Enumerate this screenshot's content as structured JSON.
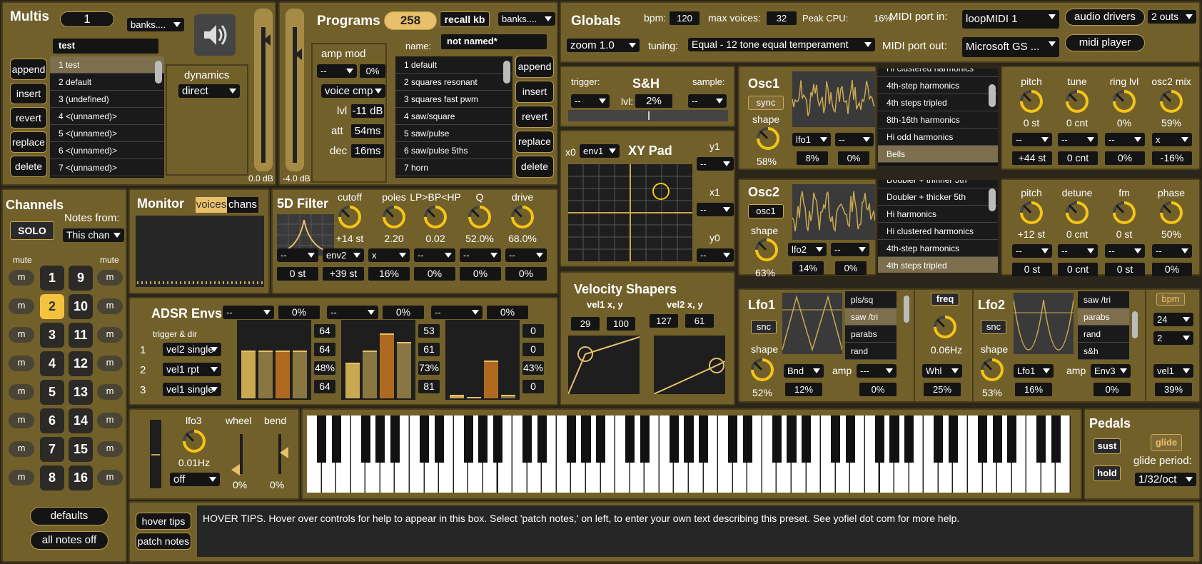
{
  "multis": {
    "title": "Multis",
    "number": "1",
    "banks": "banks....",
    "name": "test",
    "volume": "0.0 dB",
    "buttons": [
      "append",
      "insert",
      "revert",
      "replace",
      "delete"
    ],
    "list": [
      "1 test",
      "2 default",
      "3 (undefined)",
      "4 <(unnamed)>",
      "5 <(unnamed)>",
      "6 <(unnamed)>",
      "7 <(unnamed)>"
    ],
    "dynamics_label": "dynamics",
    "dynamics": "direct"
  },
  "programs": {
    "title": "Programs",
    "number": "258",
    "recall": "recall kb",
    "banks": "banks....",
    "name_label": "name:",
    "name": "not named*",
    "volume": "-4.0 dB",
    "buttons": [
      "append",
      "insert",
      "revert",
      "replace",
      "delete"
    ],
    "list": [
      "1 default",
      "2 squares resonant",
      "3 squares fast pwm",
      "4 saw/square",
      "5 saw/pulse",
      "6 saw/pulse 5ths",
      "7 horn"
    ],
    "amp_mod": {
      "title": "amp mod",
      "src": "--",
      "pct": "0%",
      "mode": "voice cmp",
      "lvl_label": "lvl",
      "lvl": "-11 dB",
      "att_label": "att",
      "att": "54ms",
      "dec_label": "dec",
      "dec": "16ms"
    }
  },
  "globals": {
    "title": "Globals",
    "bpm_label": "bpm:",
    "bpm": "120",
    "maxv_label": "max voices:",
    "maxv": "32",
    "cpu_label": "Peak CPU:",
    "cpu": "16%",
    "midi_in_label": "MIDI port in:",
    "midi_in": "loopMIDI 1",
    "audio_drivers": "audio drivers",
    "outs": "2 outs",
    "zoom": "zoom 1.0",
    "tuning_label": "tuning:",
    "tuning": "Equal - 12 tone equal temperament",
    "midi_out_label": "MIDI port out:",
    "midi_out": "Microsoft GS ...",
    "midi_player": "midi player"
  },
  "sh": {
    "title": "S&H",
    "trigger": "trigger:",
    "sample": "sample:",
    "lvl_label": "lvl:",
    "lvl": "2%",
    "trig_dd": "--",
    "samp_dd": "--"
  },
  "xy": {
    "title": "XY Pad",
    "x0": "x0",
    "x0_src": "env1",
    "y1": "y1",
    "x1": "x1",
    "y0": "y0",
    "dd": "--"
  },
  "osc1": {
    "title": "Osc1",
    "sync": "sync",
    "shape_label": "shape",
    "shape": "58%",
    "lfo": "lfo1",
    "lfo_pct": "8%",
    "dd2": "--",
    "dd2_pct": "0%",
    "list": [
      "Hi clustered harmonics",
      "4th-step harmonics",
      "4th steps tripled",
      "8th-16th harmonics",
      "Hi odd harmonics",
      "Bells"
    ],
    "knobs": [
      {
        "label": "pitch",
        "value": "0 st",
        "dd": "--",
        "box": "+44 st"
      },
      {
        "label": "tune",
        "value": "0 cnt",
        "dd": "--",
        "box": "0 cnt"
      },
      {
        "label": "ring lvl",
        "value": "0%",
        "dd": "--",
        "box": "0%"
      },
      {
        "label": "osc2 mix",
        "value": "59%",
        "dd": "x",
        "box": "-16%"
      }
    ]
  },
  "osc2": {
    "title": "Osc2",
    "src": "osc1",
    "shape_label": "shape",
    "shape": "63%",
    "lfo": "lfo2",
    "lfo_pct": "14%",
    "dd2": "--",
    "dd2_pct": "0%",
    "list": [
      "Doubler + thinner 5th",
      "Doubler + thicker 5th",
      "Hi harmonics",
      "Hi clustered harmonics",
      "4th-step harmonics",
      "4th steps tripled"
    ],
    "knobs": [
      {
        "label": "pitch",
        "value": "+12 st",
        "dd": "--",
        "box": "0 st"
      },
      {
        "label": "detune",
        "value": "0 cnt",
        "dd": "--",
        "box": "0 cnt"
      },
      {
        "label": "fm",
        "value": "0 st",
        "dd": "--",
        "box": "0 st"
      },
      {
        "label": "phase",
        "value": "50%",
        "dd": "--",
        "box": "0%"
      }
    ]
  },
  "channels": {
    "title": "Channels",
    "notes_from": "Notes from:",
    "solo": "SOLO",
    "chan": "This chan",
    "mute": "mute",
    "m": "m",
    "numbers": [
      "1",
      "2",
      "3",
      "4",
      "5",
      "6",
      "7",
      "8",
      "9",
      "10",
      "11",
      "12",
      "13",
      "14",
      "15",
      "16"
    ],
    "defaults": "defaults",
    "all_notes_off": "all notes off"
  },
  "monitor": {
    "title": "Monitor",
    "voices": "voices",
    "chans": "chans"
  },
  "filter": {
    "title": "5D Filter",
    "knobs": [
      {
        "label": "cutoff",
        "value": "+14 st"
      },
      {
        "label": "poles",
        "value": "2.20"
      },
      {
        "label": "LP>BP<HP",
        "value": "0.02"
      },
      {
        "label": "Q",
        "value": "52.0%"
      },
      {
        "label": "drive",
        "value": "68.0%"
      }
    ],
    "mods": [
      {
        "dd": "--",
        "val": "0 st"
      },
      {
        "dd": "env2",
        "val": "+39 st"
      },
      {
        "dd": "x",
        "val": "16%"
      },
      {
        "dd": "--",
        "val": "0%"
      },
      {
        "dd": "--",
        "val": "0%"
      },
      {
        "dd": "--",
        "val": "0%"
      }
    ]
  },
  "adsr": {
    "title": "ADSR Envs",
    "trigger": "trigger & dir",
    "rows": [
      {
        "n": "1",
        "mode": "vel2 single"
      },
      {
        "n": "2",
        "mode": "vel1 rpt"
      },
      {
        "n": "3",
        "mode": "vel1 single"
      }
    ],
    "heads": [
      {
        "dd": "--",
        "pct": "0%"
      },
      {
        "dd": "--",
        "pct": "0%"
      },
      {
        "dd": "--",
        "pct": "0%"
      }
    ],
    "env1": [
      "64",
      "64",
      "48%",
      "64"
    ],
    "env2": [
      "53",
      "61",
      "73%",
      "81"
    ],
    "env3": [
      "0",
      "0",
      "43%",
      "0"
    ]
  },
  "velocity": {
    "title": "Velocity Shapers",
    "v1": "vel1 x, y",
    "v1x": "29",
    "v1y": "100",
    "v2": "vel2 x, y",
    "v2x": "127",
    "v2y": "61"
  },
  "lfo1": {
    "title": "Lfo1",
    "snc": "snc",
    "shape_label": "shape",
    "shape": "52%",
    "mod": "Bnd",
    "mod_pct": "12%",
    "amp": "amp",
    "amp_dd": "---",
    "amp_pct": "0%",
    "list": [
      "pls/sq",
      "saw /tri",
      "parabs",
      "rand"
    ],
    "freq": "freq",
    "hz": "0.06Hz",
    "whl": "Whl",
    "whl_pct": "25%"
  },
  "lfo2": {
    "title": "Lfo2",
    "snc": "snc",
    "shape_label": "shape",
    "shape": "53%",
    "mod": "Lfo1",
    "mod_pct": "16%",
    "amp": "amp",
    "amp_dd": "Env3",
    "amp_pct": "0%",
    "list": [
      "saw /tri",
      "parabs",
      "rand",
      "s&h"
    ],
    "bpm": "bpm",
    "d1": "24",
    "d2": "2",
    "vel": "vel1",
    "vel_pct": "39%"
  },
  "perf": {
    "lfo3": "lfo3",
    "hz": "0.01Hz",
    "off": "off",
    "wheel": "wheel",
    "bend": "bend",
    "wheel_pct": "0%",
    "bend_pct": "0%"
  },
  "pedals": {
    "title": "Pedals",
    "sust": "sust",
    "glide": "glide",
    "hold": "hold",
    "period_label": "glide period:",
    "period": "1/32/oct"
  },
  "tips": {
    "hover": "hover tips",
    "patch": "patch notes",
    "text": "HOVER TIPS. Hover over controls for help to appear in this box. Select 'patch notes,' on left, to enter your own text describing this preset. See yofiel dot com for more help."
  }
}
